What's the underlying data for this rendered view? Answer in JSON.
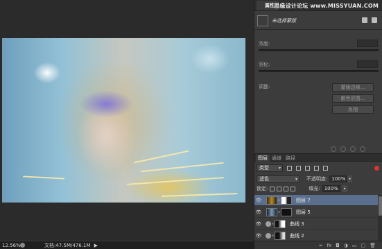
{
  "status": {
    "zoom": "12.56%",
    "doc": "文档:47.5M/476.1M",
    "arrow": "▶"
  },
  "properties": {
    "tab": "属性",
    "watermark": "思缘设计论坛 www.MISSYUAN.COM",
    "title": "未选择蒙版",
    "density_label": "浓度:",
    "feather_label": "羽化:",
    "adjust_label": "调整:",
    "buttons": [
      "蒙版边缘...",
      "颜色范围...",
      "反相"
    ]
  },
  "layers_panel": {
    "tabs": [
      "图层",
      "通道",
      "路径"
    ],
    "filter_kind": "类型",
    "blend_mode": "滤色",
    "opacity_label": "不透明度:",
    "opacity_value": "100%",
    "lock_label": "锁定:",
    "fill_label": "填充:",
    "fill_value": "100%",
    "layers": [
      {
        "name": "图层 7",
        "selected": true,
        "kind": "pixel"
      },
      {
        "name": "图层 5",
        "selected": false,
        "kind": "pixel"
      },
      {
        "name": "曲线 3",
        "selected": false,
        "kind": "adjustment"
      },
      {
        "name": "曲线 2",
        "selected": false,
        "kind": "adjustment"
      }
    ],
    "footer_icons": [
      "link-icon",
      "fx-icon",
      "mask-icon",
      "adjustment-icon",
      "folder-icon",
      "new-layer-icon",
      "trash-icon"
    ]
  },
  "colors": {
    "selected_layer": "#5a6f8e",
    "panel_bg": "#3c3c3c",
    "workspace_bg": "#2b2b2b"
  }
}
